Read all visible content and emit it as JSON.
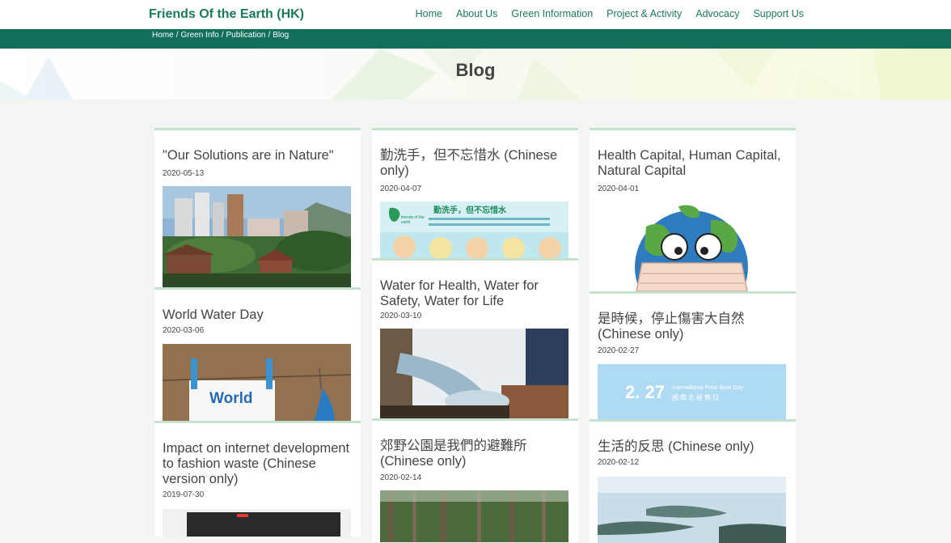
{
  "header": {
    "brand": "Friends Of the Earth (HK)",
    "nav": [
      "Home",
      "About Us",
      "Green Information",
      "Project & Activity",
      "Advocacy",
      "Support Us"
    ]
  },
  "breadcrumb": [
    "Home",
    "Green Info",
    "Publication",
    "Blog"
  ],
  "breadcrumb_separator": "/",
  "page_title": "Blog",
  "colors": {
    "brand_green": "#1b7a55",
    "crumb_bar": "#12705a",
    "card_border": "#c3e1cc",
    "background": "#f2f5f2"
  },
  "posts": [
    {
      "title": "\"Our Solutions are in Nature\"",
      "date": "2020-05-13",
      "image": "city-garden-photo"
    },
    {
      "title": "勤洗手，但不忘惜水 (Chinese only)",
      "date": "2020-04-07",
      "image": "handwash-poster",
      "image_text": {
        "heading": "勤洗手，但不忘惜水",
        "logo": "friends of the earth"
      }
    },
    {
      "title": "Health Capital, Human Capital, Natural Capital",
      "date": "2020-04-01",
      "image": "earth-mask-drawing"
    },
    {
      "title": "World Water Day",
      "date": "2020-03-06",
      "image": "world-water-day-sign",
      "image_text": {
        "sign": "World"
      }
    },
    {
      "title": "Water for Health, Water for Safety, Water for Life",
      "date": "2020-03-10",
      "image": "water-pouring-photo"
    },
    {
      "title": "是時候，停止傷害大自然 (Chinese only)",
      "date": "2020-02-27",
      "image": "polar-bear-day-banner",
      "image_text": {
        "date": "2. 27",
        "event_en": "International Polar Bear Day",
        "event_zh": "國際北極熊日"
      }
    },
    {
      "title": "Impact on internet development to fashion waste (Chinese version only)",
      "date": "2019-07-30",
      "image": "laptop-photo"
    },
    {
      "title": "郊野公園是我們的避難所 (Chinese only)",
      "date": "2020-02-14",
      "image": "forest-photo"
    },
    {
      "title": "生活的反思 (Chinese only)",
      "date": "2020-02-12",
      "image": "aerial-coast-photo"
    }
  ]
}
